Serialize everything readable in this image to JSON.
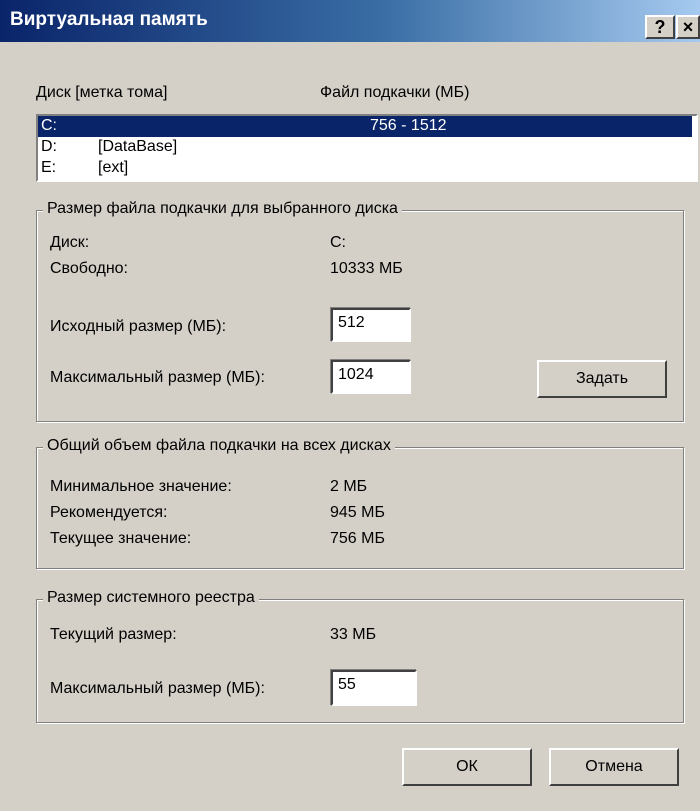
{
  "window": {
    "title": "Виртуальная память",
    "help_btn": "?",
    "close_btn": "×"
  },
  "drives": {
    "col_disk": "Диск [метка тома]",
    "col_pagefile": "Файл подкачки (МБ)",
    "rows": [
      {
        "letter": "C:",
        "label": "",
        "size": "756 - 1512",
        "selected": true
      },
      {
        "letter": "D:",
        "label": "[DataBase]",
        "size": ""
      },
      {
        "letter": "E:",
        "label": "[ext]",
        "size": ""
      }
    ]
  },
  "selected_drive": {
    "legend": "Размер файла подкачки для выбранного диска",
    "disk_label": "Диск:",
    "disk_value": "C:",
    "free_label": "Свободно:",
    "free_value": "10333 МБ",
    "initial_label": "Исходный размер (МБ):",
    "initial_value": "512",
    "max_label": "Максимальный размер (МБ):",
    "max_value": "1024",
    "set_button": "Задать"
  },
  "total": {
    "legend": "Общий объем файла подкачки на всех дисках",
    "min_label": "Минимальное значение:",
    "min_value": "2 МБ",
    "rec_label": "Рекомендуется:",
    "rec_value": "945 МБ",
    "cur_label": "Текущее значение:",
    "cur_value": "756 МБ"
  },
  "registry": {
    "legend": "Размер системного реестра",
    "cur_label": "Текущий размер:",
    "cur_value": "33 МБ",
    "max_label": "Максимальный размер (МБ):",
    "max_value": "55"
  },
  "buttons": {
    "ok": "ОК",
    "cancel": "Отмена"
  }
}
